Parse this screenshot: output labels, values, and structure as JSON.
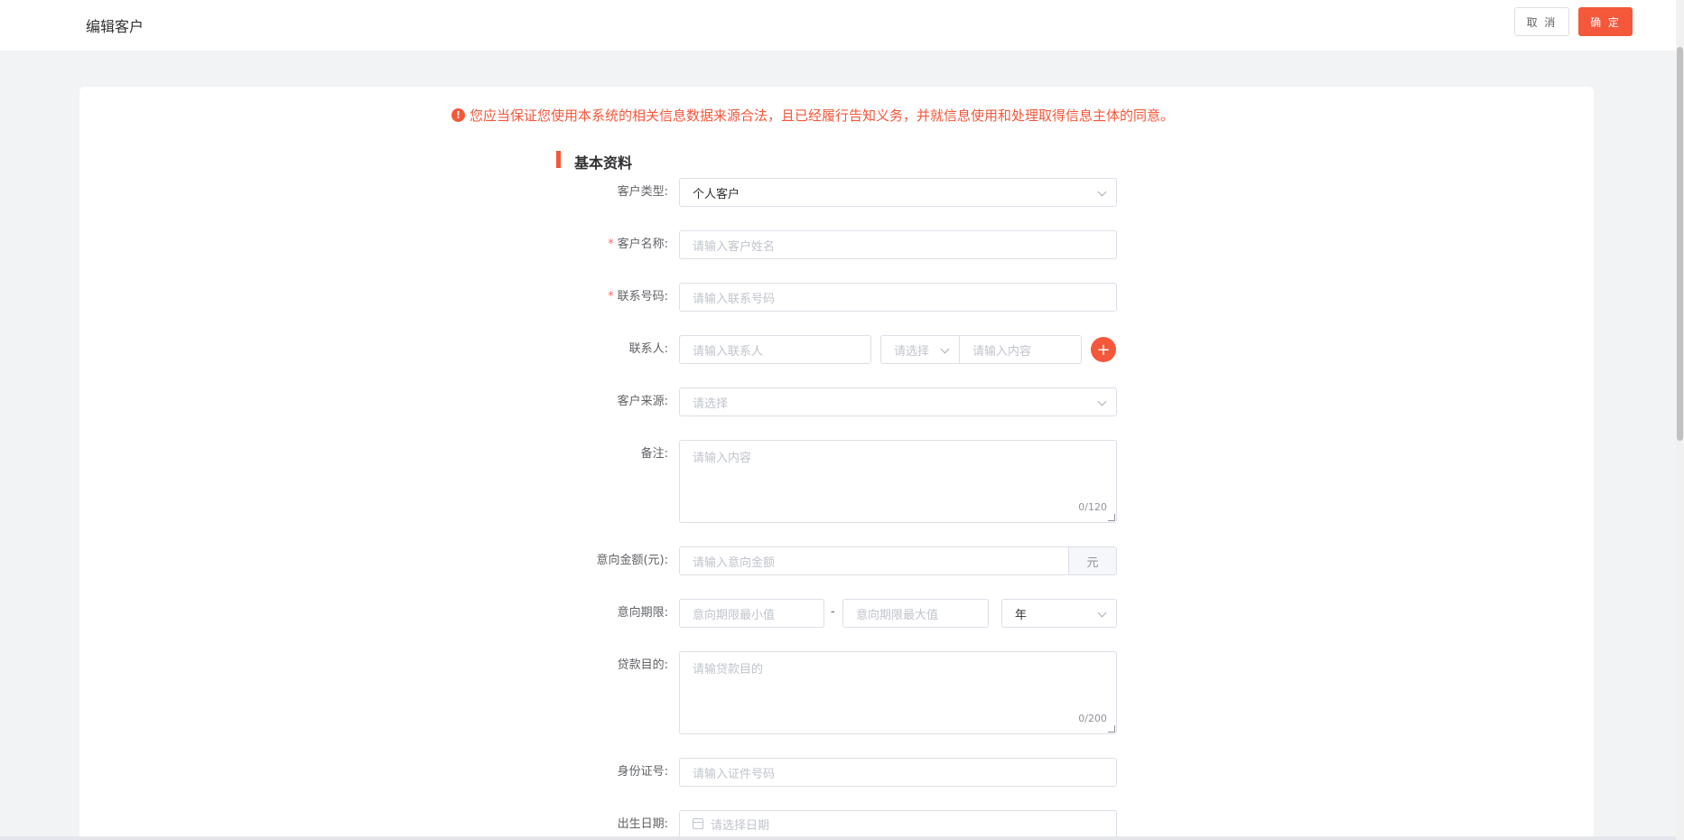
{
  "header": {
    "title": "编辑客户",
    "cancel_label": "取 消",
    "confirm_label": "确 定"
  },
  "notice": {
    "icon": "exclamation-circle-icon",
    "text": "您应当保证您使用本系统的相关信息数据来源合法，且已经履行告知义务，并就信息使用和处理取得信息主体的同意。"
  },
  "section": {
    "title": "基本资料"
  },
  "form": {
    "customer_type": {
      "label": "客户类型:",
      "value": "个人客户"
    },
    "customer_name": {
      "label": "客户名称:",
      "required": "*",
      "placeholder": "请输入客户姓名"
    },
    "phone": {
      "label": "联系号码:",
      "required": "*",
      "placeholder": "请输入联系号码"
    },
    "contact": {
      "label": "联系人:",
      "name_placeholder": "请输入联系人",
      "type_placeholder": "请选择",
      "content_placeholder": "请输入内容",
      "add_icon": "plus-icon"
    },
    "source": {
      "label": "客户来源:",
      "placeholder": "请选择"
    },
    "remark": {
      "label": "备注:",
      "placeholder": "请输入内容",
      "counter": "0/120"
    },
    "amount": {
      "label": "意向金额(元):",
      "placeholder": "请输入意向金额",
      "unit": "元"
    },
    "term": {
      "label": "意向期限:",
      "min_placeholder": "意向期限最小值",
      "separator": "-",
      "max_placeholder": "意向期限最大值",
      "unit_value": "年"
    },
    "loan_purpose": {
      "label": "贷款目的:",
      "placeholder": "请输贷款目的",
      "counter": "0/200"
    },
    "id_number": {
      "label": "身份证号:",
      "placeholder": "请输入证件号码"
    },
    "birth_date": {
      "label": "出生日期:",
      "placeholder": "请选择日期",
      "icon": "calendar-icon"
    }
  },
  "colors": {
    "accent": "#f5573b",
    "background": "#f2f3f5",
    "border": "#dcdfe6",
    "placeholder": "#c0c4cc"
  }
}
